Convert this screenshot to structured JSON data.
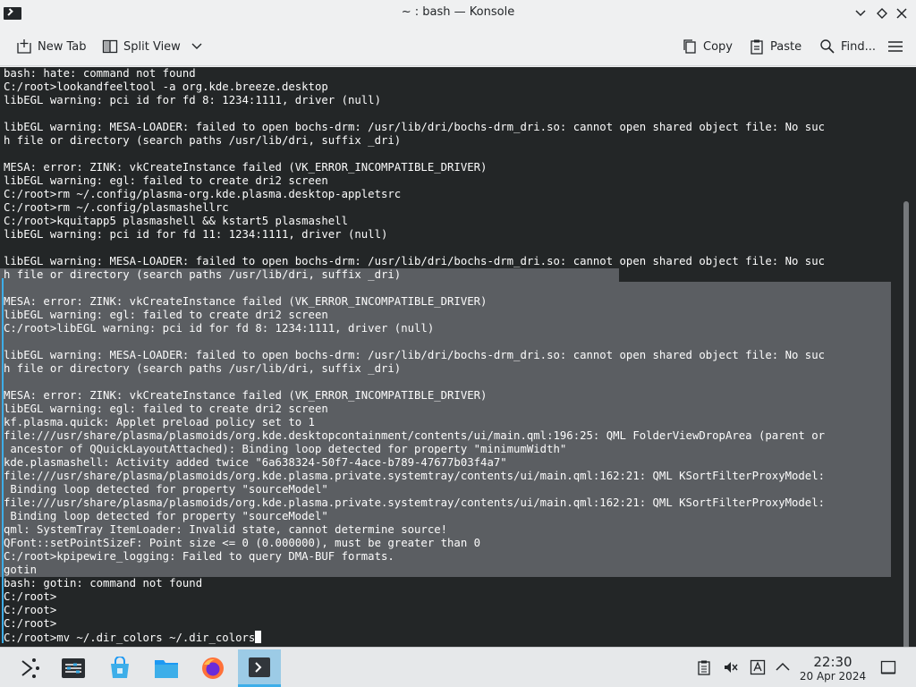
{
  "window": {
    "title": "~ : bash — Konsole"
  },
  "toolbar": {
    "new_tab": "New Tab",
    "split_view": "Split View",
    "copy": "Copy",
    "paste": "Paste",
    "find": "Find..."
  },
  "terminal": {
    "lines": [
      "bash: hate: command not found",
      "C:/root>lookandfeeltool -a org.kde.breeze.desktop",
      "libEGL warning: pci id for fd 8: 1234:1111, driver (null)",
      "",
      "libEGL warning: MESA-LOADER: failed to open bochs-drm: /usr/lib/dri/bochs-drm_dri.so: cannot open shared object file: No suc",
      "h file or directory (search paths /usr/lib/dri, suffix _dri)",
      "",
      "MESA: error: ZINK: vkCreateInstance failed (VK_ERROR_INCOMPATIBLE_DRIVER)",
      "libEGL warning: egl: failed to create dri2 screen",
      "C:/root>rm ~/.config/plasma-org.kde.plasma.desktop-appletsrc",
      "C:/root>rm ~/.config/plasmashellrc",
      "C:/root>kquitapp5 plasmashell && kstart5 plasmashell",
      "libEGL warning: pci id for fd 11: 1234:1111, driver (null)",
      "",
      "libEGL warning: MESA-LOADER: failed to open bochs-drm: /usr/lib/dri/bochs-drm_dri.so: cannot open shared object file: No suc",
      "h file or directory (search paths /usr/lib/dri, suffix _dri)",
      "",
      "MESA: error: ZINK: vkCreateInstance failed (VK_ERROR_INCOMPATIBLE_DRIVER)",
      "libEGL warning: egl: failed to create dri2 screen",
      "C:/root>libEGL warning: pci id for fd 8: 1234:1111, driver (null)",
      "",
      "libEGL warning: MESA-LOADER: failed to open bochs-drm: /usr/lib/dri/bochs-drm_dri.so: cannot open shared object file: No suc",
      "h file or directory (search paths /usr/lib/dri, suffix _dri)",
      "",
      "MESA: error: ZINK: vkCreateInstance failed (VK_ERROR_INCOMPATIBLE_DRIVER)",
      "libEGL warning: egl: failed to create dri2 screen",
      "kf.plasma.quick: Applet preload policy set to 1",
      "file:///usr/share/plasma/plasmoids/org.kde.desktopcontainment/contents/ui/main.qml:196:25: QML FolderViewDropArea (parent or",
      " ancestor of QQuickLayoutAttached): Binding loop detected for property \"minimumWidth\"",
      "kde.plasmashell: Activity added twice \"6a638324-50f7-4ace-b789-47677b03f4a7\"",
      "file:///usr/share/plasma/plasmoids/org.kde.plasma.private.systemtray/contents/ui/main.qml:162:21: QML KSortFilterProxyModel:",
      " Binding loop detected for property \"sourceModel\"",
      "file:///usr/share/plasma/plasmoids/org.kde.plasma.private.systemtray/contents/ui/main.qml:162:21: QML KSortFilterProxyModel:",
      " Binding loop detected for property \"sourceModel\"",
      "qml: SystemTray ItemLoader: Invalid state, cannot determine source!",
      "QFont::setPointSizeF: Point size <= 0 (0.000000), must be greater than 0",
      "C:/root>kpipewire_logging: Failed to query DMA-BUF formats.",
      "gotin",
      "bash: gotin: command not found",
      "C:/root>",
      "C:/root>",
      "C:/root>",
      "C:/root>mv ~/.dir_colors ~/.dir_colors"
    ]
  },
  "taskbar": {
    "time": "22:30",
    "date": "20 Apr 2024"
  },
  "colors": {
    "terminal_bg": "#232627",
    "terminal_fg": "#fcfcfc",
    "selection": "#5b5e62",
    "accent": "#3daee9"
  }
}
